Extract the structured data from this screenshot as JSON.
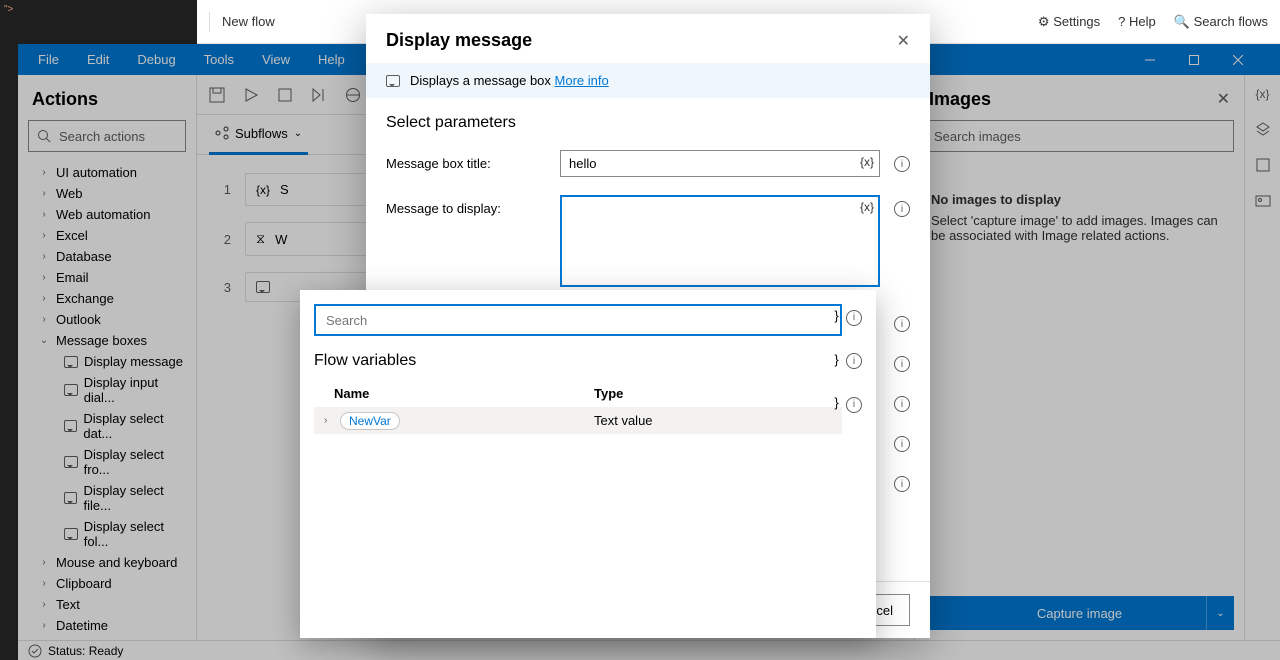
{
  "top_ribbon": {
    "new_flow": "New flow",
    "settings": "Settings",
    "help": "Help",
    "search": "Search flows"
  },
  "menu": [
    "File",
    "Edit",
    "Debug",
    "Tools",
    "View",
    "Help"
  ],
  "actions_panel": {
    "title": "Actions",
    "search_placeholder": "Search actions",
    "groups": [
      "UI automation",
      "Web",
      "Web automation",
      "Excel",
      "Database",
      "Email",
      "Exchange",
      "Outlook",
      "Message boxes",
      "Mouse and keyboard",
      "Clipboard",
      "Text",
      "Datetime"
    ],
    "message_box_items": [
      "Display message",
      "Display input dial...",
      "Display select dat...",
      "Display select fro...",
      "Display select file...",
      "Display select fol..."
    ]
  },
  "subflows_label": "Subflows",
  "images_panel": {
    "title": "Images",
    "search_placeholder": "Search images",
    "empty_title": "No images to display",
    "empty_body": "Select 'capture image' to add images. Images can be associated with Image related actions.",
    "capture_label": "Capture image"
  },
  "status": "Status: Ready",
  "dialog": {
    "title": "Display message",
    "banner_text": "Displays a message box",
    "banner_link": "More info",
    "section": "Select parameters",
    "label_title": "Message box title:",
    "label_message": "Message to display:",
    "value_title": "hello",
    "cancel": "Cancel"
  },
  "var_popup": {
    "search_placeholder": "Search",
    "heading": "Flow variables",
    "col_name": "Name",
    "col_type": "Type",
    "row_name": "NewVar",
    "row_type": "Text value"
  }
}
